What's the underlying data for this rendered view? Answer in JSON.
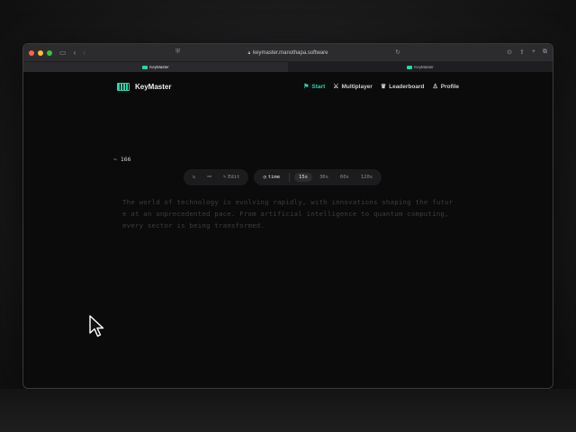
{
  "browser": {
    "url": "keymaster.manothapa.software",
    "tabs": [
      {
        "label": "KeyMaster",
        "active": true
      },
      {
        "label": "KeyMaster",
        "active": false
      }
    ]
  },
  "app": {
    "brand": "KeyMaster",
    "accent": "#2dd4a7",
    "nav": [
      {
        "label": "Start",
        "icon": "flag-icon",
        "active": true
      },
      {
        "label": "Multiplayer",
        "icon": "swords-icon",
        "active": false
      },
      {
        "label": "Leaderboard",
        "icon": "crown-icon",
        "active": false
      },
      {
        "label": "Profile",
        "icon": "user-icon",
        "active": false
      }
    ]
  },
  "test": {
    "word_count": "~ 166",
    "controls": {
      "restart_icon": "refresh-icon",
      "link_icon": "link-icon",
      "edit_label": "Edit",
      "time_label": "time",
      "durations": [
        "15s",
        "30s",
        "60s",
        "120s"
      ],
      "selected_duration": "15s"
    },
    "text": "The world of technology is evolving rapidly, with innovations shaping the future at an unprecedented pace. From artificial intelligence to quantum computing, every sector is being transformed."
  }
}
